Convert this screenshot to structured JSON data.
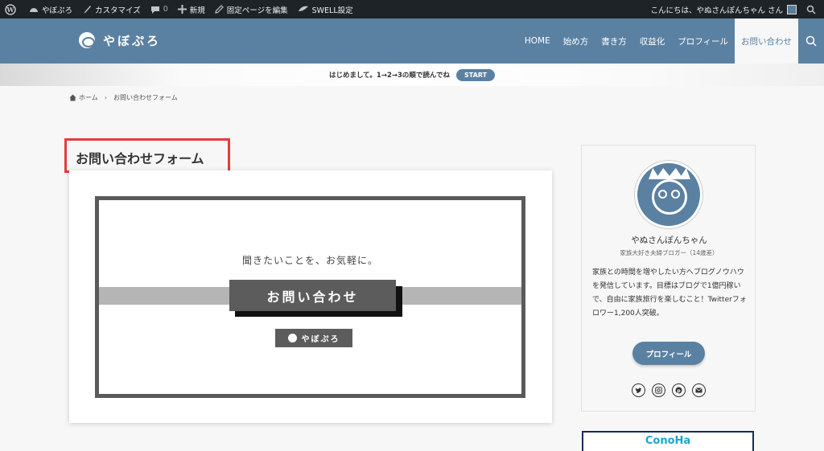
{
  "admin_bar": {
    "site_name": "やぼぷろ",
    "customize": "カスタマイズ",
    "comments_count": "0",
    "new": "新規",
    "edit_page": "固定ページを編集",
    "swell": "SWELL設定",
    "greeting": "こんにちは、やぬさんぽんちゃん さん"
  },
  "header": {
    "logo_text": "やぼぷろ",
    "nav": [
      "HOME",
      "始め方",
      "書き方",
      "収益化",
      "プロフィール",
      "お問い合わせ"
    ],
    "active_nav": "お問い合わせ"
  },
  "info_bar": {
    "text": "はじめまして。1→2→3の順で読んでね",
    "button": "START"
  },
  "breadcrumb": {
    "home": "ホーム",
    "current": "お問い合わせフォーム"
  },
  "main": {
    "title": "お問い合わせフォーム",
    "banner": {
      "tagline": "聞きたいことを、お気軽に。",
      "button": "お問い合わせ",
      "logo": "やぼぷろ"
    }
  },
  "sidebar": {
    "name": "やぬさんぽんちゃん",
    "subtitle": "家族大好き夫婦ブロガー（14歳差）",
    "bio": "家族との時間を増やしたい方へブログノウハウを発信しています。目標はブログで1億円稼いで、自由に家族旅行を楽しむこと！Twitterフォロワー1,200人突破。",
    "profile_button": "プロフィール",
    "sns": [
      "twitter-icon",
      "instagram-icon",
      "pinterest-icon",
      "mail-icon"
    ],
    "ad_text": "ConoHa"
  },
  "colors": {
    "brand": "#5b81a2",
    "adminbar": "#1d2327",
    "highlight_border": "#e63b3b"
  }
}
